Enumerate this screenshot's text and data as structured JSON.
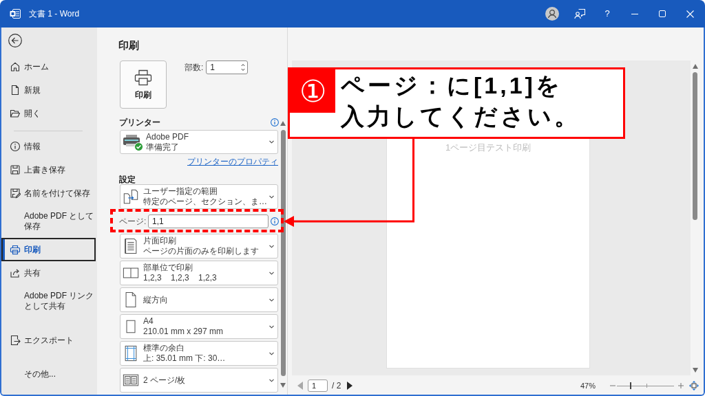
{
  "window": {
    "title": "文書 1 - Word",
    "help": "?"
  },
  "sidebar": {
    "groups": [
      {
        "items": [
          {
            "label": "ホーム",
            "selected": false
          },
          {
            "label": "新規",
            "selected": false
          },
          {
            "label": "開く",
            "selected": false
          }
        ]
      },
      {
        "items": [
          {
            "label": "情報",
            "selected": false
          },
          {
            "label": "上書き保存",
            "selected": false
          },
          {
            "label": "名前を付けて保存",
            "selected": false
          },
          {
            "label": "Adobe PDF として保存",
            "selected": false
          },
          {
            "label": "印刷",
            "selected": true
          },
          {
            "label": "共有",
            "selected": false
          },
          {
            "label": "Adobe PDF リンクとして共有",
            "selected": false
          }
        ]
      },
      {
        "items": [
          {
            "label": "エクスポート",
            "selected": false
          }
        ]
      },
      {
        "items": [
          {
            "label": "その他...",
            "selected": false
          }
        ]
      }
    ]
  },
  "print_panel": {
    "title": "印刷",
    "print_button": "印刷",
    "copies": {
      "label": "部数:",
      "value": "1"
    },
    "printer": {
      "heading": "プリンター",
      "name": "Adobe PDF",
      "status": "準備完了",
      "ready": true,
      "properties_link": "プリンターのプロパティ"
    },
    "settings": {
      "heading": "設定",
      "items": [
        {
          "kind": "dropdown",
          "title": "ユーザー指定の範囲",
          "subtitle": "特定のページ、セクション、ま…"
        },
        {
          "kind": "pages",
          "label": "ページ:",
          "value": "1,1"
        },
        {
          "kind": "dropdown",
          "title": "片面印刷",
          "subtitle": "ページの片面のみを印刷します"
        },
        {
          "kind": "dropdown",
          "title": "部単位で印刷",
          "subtitle": "1,2,3    1,2,3    1,2,3"
        },
        {
          "kind": "dropdown",
          "title": "縦方向"
        },
        {
          "kind": "dropdown",
          "title": "A4",
          "subtitle": "210.01 mm x 297 mm"
        },
        {
          "kind": "dropdown",
          "title": "標準の余白",
          "subtitle": "上: 35.01 mm 下: 30…"
        },
        {
          "kind": "dropdown",
          "title": "2 ページ/枚"
        }
      ]
    }
  },
  "preview": {
    "page_text": "1ページ目テスト印刷",
    "previous_disabled": true,
    "current_page": "1",
    "total_pages": "/ 2",
    "next_disabled": false,
    "zoom": {
      "percent": "47%",
      "level": 0.24
    }
  },
  "annotation": {
    "step": "①",
    "text": "ページ：に[1,1]を入力してください。"
  }
}
